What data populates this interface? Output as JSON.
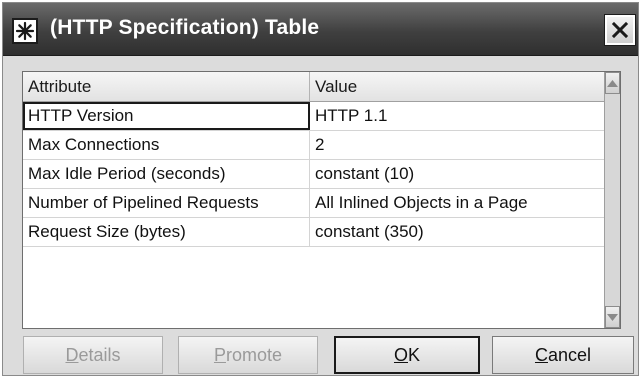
{
  "window": {
    "title": "(HTTP Specification) Table"
  },
  "table": {
    "columns": [
      "Attribute",
      "Value"
    ],
    "rows": [
      {
        "attribute": "HTTP Version",
        "value": "HTTP 1.1"
      },
      {
        "attribute": "Max Connections",
        "value": "2"
      },
      {
        "attribute": "Max Idle Period (seconds)",
        "value": "constant (10)"
      },
      {
        "attribute": "Number of Pipelined Requests",
        "value": "All Inlined Objects in a Page"
      },
      {
        "attribute": "Request Size (bytes)",
        "value": "constant (350)"
      }
    ]
  },
  "buttons": {
    "details": {
      "first": "D",
      "rest": "etails",
      "enabled": false
    },
    "promote": {
      "first": "P",
      "rest": "romote",
      "enabled": false
    },
    "ok": {
      "first": "O",
      "rest": "K",
      "enabled": true
    },
    "cancel": {
      "first": "C",
      "rest": "ancel",
      "enabled": true
    }
  },
  "icons": {
    "app": "asterisk-star-icon",
    "close": "close-icon",
    "scroll_up": "scroll-up-arrow-icon",
    "scroll_down": "scroll-down-arrow-icon"
  }
}
